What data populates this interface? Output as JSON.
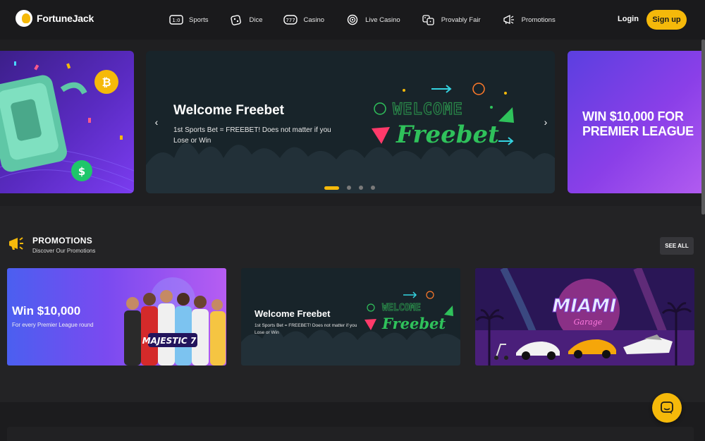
{
  "brand": {
    "name": "FortuneJack",
    "accent": "#f5b90a"
  },
  "nav": {
    "items": [
      {
        "label": "Sports",
        "icon": "scoreboard-icon"
      },
      {
        "label": "Dice",
        "icon": "dice-icon"
      },
      {
        "label": "Casino",
        "icon": "slot-777-icon"
      },
      {
        "label": "Live Casino",
        "icon": "roulette-icon"
      },
      {
        "label": "Provably Fair",
        "icon": "dice-pair-icon"
      },
      {
        "label": "Promotions",
        "icon": "megaphone-icon"
      }
    ],
    "login_label": "Login",
    "signup_label": "Sign up"
  },
  "hero": {
    "main_title": "Welcome Freebet",
    "main_subtitle": "1st Sports Bet = FREEBET! Does not matter if you Lose or Win",
    "art_title_top": "WELCOME",
    "art_title_bottom": "Freebet",
    "right_slide_text": "WIN $10,000 FOR PREMIER LEAGUE",
    "dots_total": 4,
    "active_dot": 1
  },
  "promotions": {
    "title": "PROMOTIONS",
    "subtitle": "Discover Our Promotions",
    "see_all_label": "SEE ALL",
    "cards": [
      {
        "title": "Win $10,000",
        "subtitle": "For every Premier League round",
        "badge": "MAJESTIC 7"
      },
      {
        "title": "Welcome Freebet",
        "subtitle": "1st Sports Bet = FREEBET! Does not matter if you Lose or Win",
        "art_top": "WELCOME",
        "art_bottom": "Freebet"
      },
      {
        "title": "MIAMI",
        "subtitle": "Garage"
      }
    ]
  }
}
